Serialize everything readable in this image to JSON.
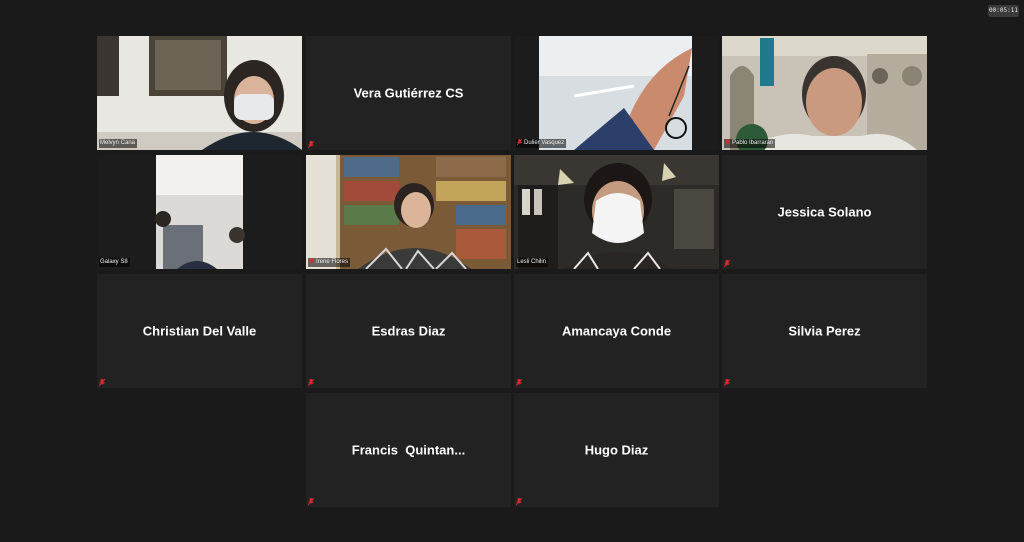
{
  "meeting": {
    "timer": "00:05:11",
    "accent_active": "#c7d94a",
    "muted_color": "#e02b2b"
  },
  "tiles": [
    {
      "label": "Melvyn Cana"
    },
    {
      "name": "Vera Gutiérrez CS"
    },
    {
      "label": "Dulier Vasquez"
    },
    {
      "label": "Pablo Ibarraran"
    },
    {
      "label": "Galaxy S8"
    },
    {
      "label": "Irene Flores"
    },
    {
      "label": "Lesli Chilin"
    },
    {
      "name": "Jessica Solano"
    },
    {
      "name": "Christian Del Valle"
    },
    {
      "name": "Esdras Diaz"
    },
    {
      "name": "Amancaya Conde"
    },
    {
      "name": "Silvia Perez"
    },
    {
      "name": "Francis  Quintan..."
    },
    {
      "name": "Hugo Diaz"
    }
  ]
}
